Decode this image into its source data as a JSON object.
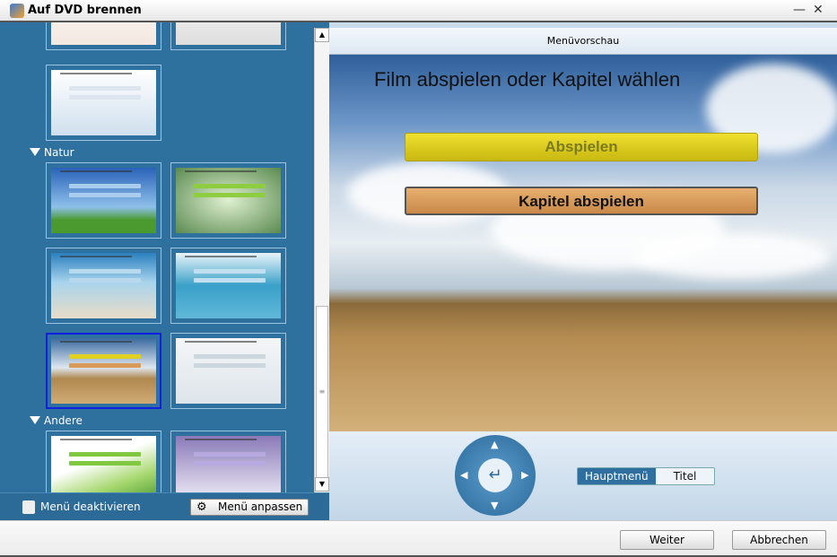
{
  "window": {
    "title": "Auf DVD brennen",
    "minimize": "—",
    "close": "✕"
  },
  "sidebar": {
    "categories": [
      {
        "label": "Natur"
      },
      {
        "label": "Andere"
      }
    ],
    "disable_menu_label": "Menü deaktivieren",
    "customize_label": "Menü anpassen"
  },
  "preview": {
    "header": "Menüvorschau",
    "title": "Film abspielen oder Kapitel wählen",
    "play_label": "Abspielen",
    "chapters_label": "Kapitel abspielen"
  },
  "controls": {
    "up": "▲",
    "down": "▼",
    "left": "◀",
    "right": "▶",
    "enter": "↵",
    "tabs": [
      {
        "label": "Hauptmenü",
        "active": true
      },
      {
        "label": "Titel",
        "active": false
      }
    ]
  },
  "footer": {
    "next_label": "Weiter",
    "cancel_label": "Abbrechen"
  },
  "colors": {
    "panel": "#2e709e",
    "selected": "#1020e0",
    "play": "#e0d020",
    "chapters": "#d89a58"
  }
}
